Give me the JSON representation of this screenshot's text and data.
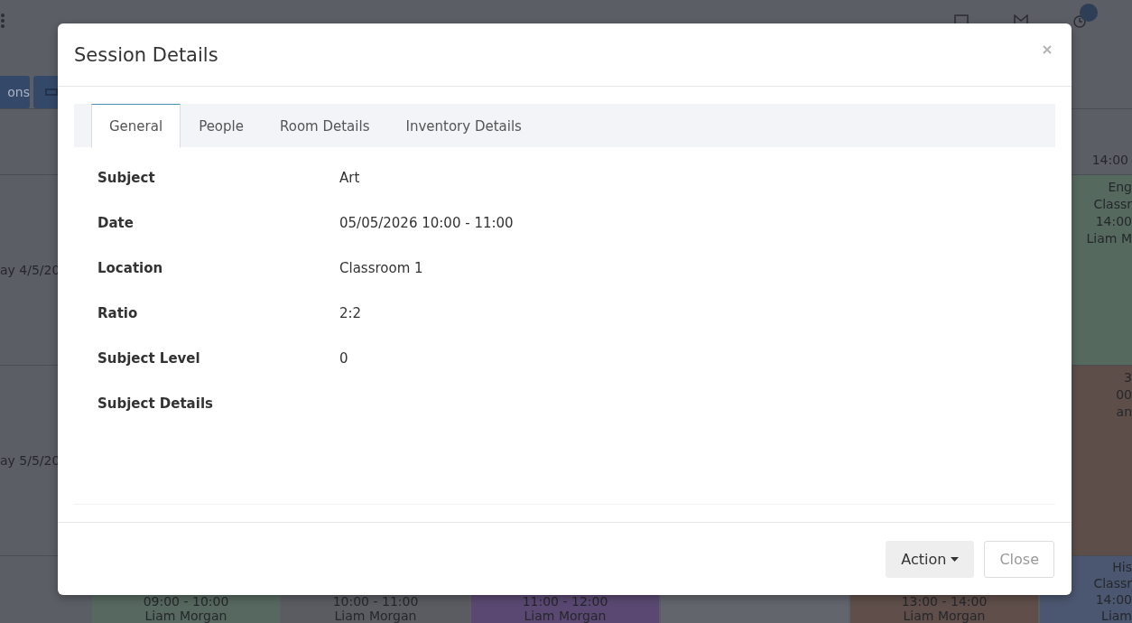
{
  "background": {
    "toolbar": {
      "button_label": "ons"
    },
    "header": {
      "time_label": "14:00"
    },
    "rows": [
      {
        "day_label": "ay 4/5/20",
        "entries": [
          {
            "lines": [
              "Eng",
              "Classr",
              "14:00",
              "Liam M"
            ],
            "color": "#55695f"
          }
        ]
      },
      {
        "day_label": "ay 5/5/20",
        "entries": [
          {
            "lines": [
              "3",
              "00",
              "an"
            ],
            "color": "#5e4e4a"
          }
        ]
      }
    ],
    "bottom_entries": [
      {
        "lines": [
          "09:00 - 10:00",
          "Liam Morgan"
        ],
        "color": "#56685f"
      },
      {
        "lines": [
          "10:00 - 11:00",
          "Liam Morgan"
        ],
        "color": "#5b5c62"
      },
      {
        "lines": [
          "11:00 - 12:00",
          "Liam Morgan"
        ],
        "color": "#5a4872"
      },
      {
        "kind": "empty"
      },
      {
        "lines": [
          "13:00 - 14:00",
          "Liam Morgan"
        ],
        "color": "#5f4e49"
      },
      {
        "lines": [
          "His",
          "Classr",
          "14:00",
          "Liam"
        ],
        "color": "#4b5670"
      }
    ]
  },
  "modal": {
    "title": "Session Details",
    "tabs": [
      {
        "label": "General",
        "selected": true
      },
      {
        "label": "People",
        "selected": false
      },
      {
        "label": "Room Details",
        "selected": false
      },
      {
        "label": "Inventory Details",
        "selected": false
      }
    ],
    "fields": [
      {
        "label": "Subject",
        "value": "Art"
      },
      {
        "label": "Date",
        "value": "05/05/2026 10:00 - 11:00"
      },
      {
        "label": "Location",
        "value": "Classroom 1"
      },
      {
        "label": "Ratio",
        "value": "2:2"
      },
      {
        "label": "Subject Level",
        "value": "0"
      },
      {
        "label": "Subject Details"
      }
    ],
    "buttons": [
      {
        "label": "Action",
        "kind": "dropdown"
      },
      {
        "label": "Close",
        "kind": "plain"
      }
    ]
  }
}
